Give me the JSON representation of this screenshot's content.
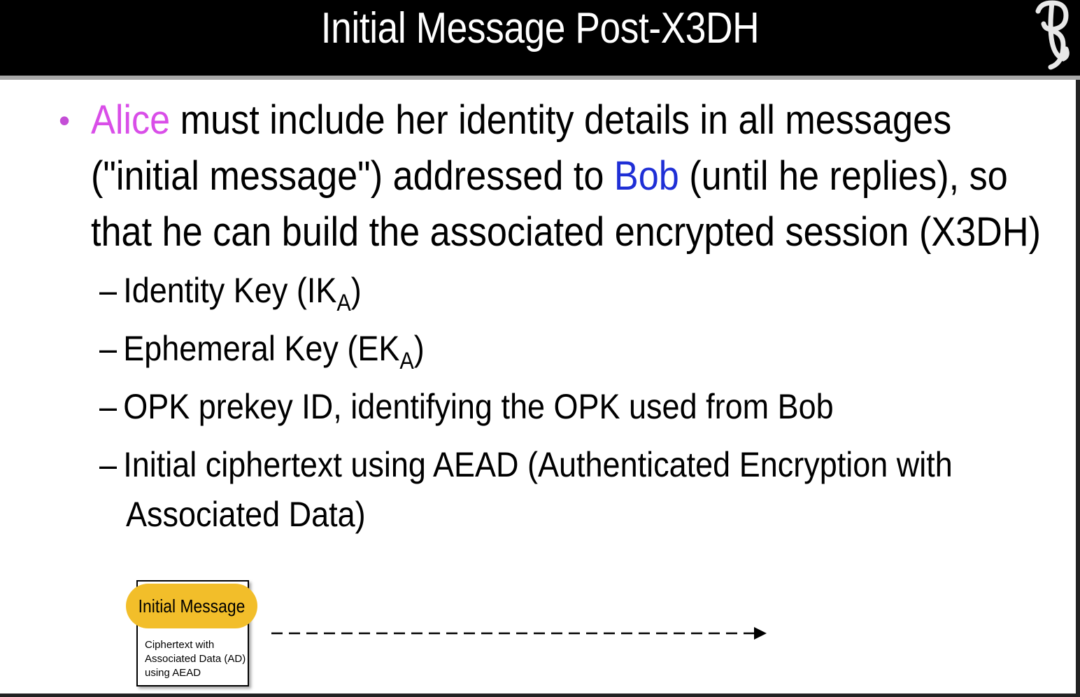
{
  "slide": {
    "title": "Initial Message Post-X3DH",
    "bullet": {
      "line1_alice": "Alice",
      "line1_rest": " must include her identity details in all messages",
      "line2_pre": "(\"initial message\") addressed to ",
      "line2_bob": "Bob",
      "line2_post": " (until he replies), so",
      "line3": "that he can build the associated encrypted session (X3DH)"
    },
    "subitems": {
      "dash": "–",
      "ik_pre": "Identity Key (IK",
      "ik_sub": "A",
      "ik_post": ")",
      "ek_pre": "Ephemeral Key (EK",
      "ek_sub": "A",
      "ek_post": ")",
      "opk": "OPK prekey ID, identifying the OPK used from Bob",
      "aead_line1": "Initial ciphertext using AEAD (Authenticated Encryption with",
      "aead_line2": "Associated Data)"
    },
    "diagram": {
      "pill_label": "Initial Message",
      "body_lines": [
        "Ciphertext with",
        "Associated Data (AD)",
        "using AEAD"
      ]
    }
  },
  "colors": {
    "alice": "#d94ee8",
    "bob": "#1f2fd6",
    "pill": "#f2be2a",
    "title_bg": "#000000"
  },
  "icons": {
    "logo": "stylized-letter-logo-icon",
    "bullet": "bullet-dot-icon",
    "arrow": "dashed-arrow-icon"
  }
}
